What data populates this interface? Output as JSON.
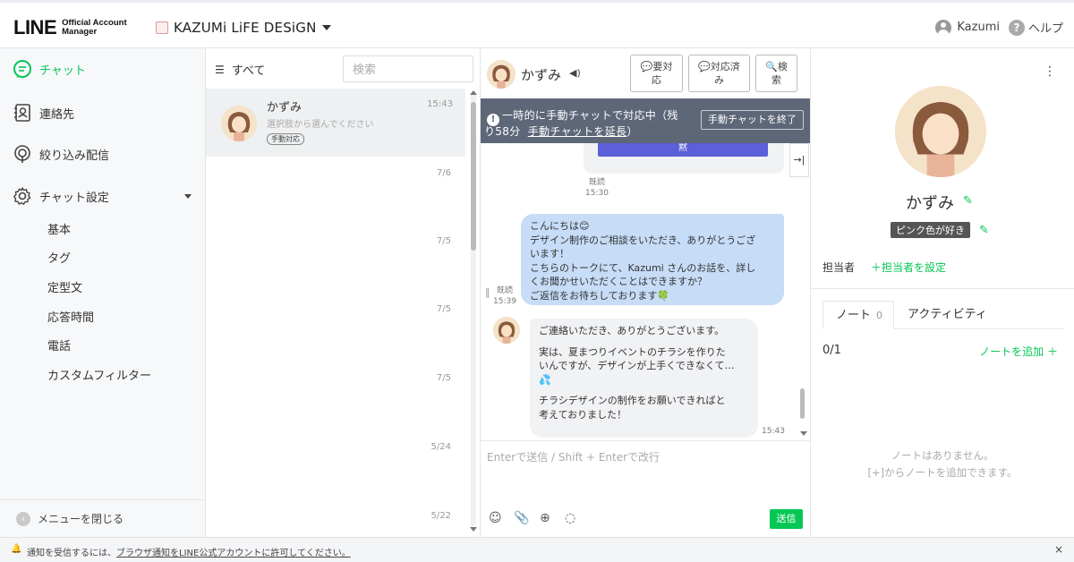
{
  "header": {
    "logo_main": "LINE",
    "logo_sub1": "Official Account",
    "logo_sub2": "Manager",
    "account_name": "KAZUMi LiFE DESiGN",
    "user_name": "Kazumi",
    "help_label": "ヘルプ"
  },
  "sidebar": {
    "items": [
      {
        "label": "チャット",
        "icon": "chat-icon"
      },
      {
        "label": "連絡先",
        "icon": "contacts-icon"
      },
      {
        "label": "絞り込み配信",
        "icon": "broadcast-icon"
      },
      {
        "label": "チャット設定",
        "icon": "gear-icon"
      }
    ],
    "sub_items": [
      "基本",
      "タグ",
      "定型文",
      "応答時間",
      "電話",
      "カスタムフィルター"
    ],
    "close_menu": "メニューを閉じる"
  },
  "chat_list": {
    "filter_label": "すべて",
    "search_placeholder": "検索",
    "rows": [
      {
        "name": "かずみ",
        "preview": "選択肢から選んでください",
        "badge": "手動対応",
        "time": "15:43"
      }
    ],
    "dates": [
      "7/6",
      "7/5",
      "7/5",
      "7/5",
      "5/24",
      "5/22"
    ]
  },
  "chat": {
    "contact_name": "かずみ",
    "buttons": {
      "needs_action_1": "要対",
      "needs_action_2": "応",
      "resolved_1": "対応済",
      "resolved_2": "み",
      "search_1": "検",
      "search_2": "索"
    },
    "banner": {
      "line1": "一時的に手動チャットで対応中（残",
      "line2_prefix": "り58分",
      "extend_link": "手動チャットを延長",
      "line2_suffix": "）",
      "end_button": "手動チャットを終了"
    },
    "card_button": "黙",
    "meta1_status": "既読",
    "meta1_time": "15:30",
    "my_message": {
      "line1": "こんにちは😊",
      "line2": "デザイン制作のご相談をいただき、ありがとうござ",
      "line3": "います！",
      "line4": "こちらのトークにて、Kazumi さんのお話を、詳し",
      "line5": "くお聞かせいただくことはできますか？",
      "line6": "ご返信をお待ちしております🍀",
      "status": "既読",
      "time": "15:39"
    },
    "their_message": {
      "line1": "ご連絡いただき、ありがとうございます。",
      "line2": "実は、夏まつりイベントのチラシを作りた",
      "line3": "いんですが、デザインが上手くできなくて…",
      "line4": "💦",
      "line5": "チラシデザインの制作をお願いできればと",
      "line6": "考えておりました！",
      "time": "15:43"
    },
    "input_placeholder": "Enterで送信 / Shift + Enterで改行",
    "send_label": "送信"
  },
  "profile": {
    "name": "かずみ",
    "tag": "ピンク色が好き",
    "assignee_label": "担当者",
    "assignee_link": "＋担当者を設定",
    "tabs": [
      {
        "label": "ノート",
        "count": "0"
      },
      {
        "label": "アクティビティ"
      }
    ],
    "note_count": "0/1",
    "add_note": "ノートを追加 ＋",
    "empty_line1": "ノートはありません。",
    "empty_line2": "[+]からノートを追加できます。"
  },
  "notification": {
    "prefix": "通知を受信するには、",
    "link": "ブラウザ通知をLINE公式アカウントに許可してください。"
  },
  "colors": {
    "accent": "#06c755",
    "banner": "#5e6778",
    "my_bubble": "#c6dcf7",
    "their_bubble": "#f1f2f4"
  }
}
